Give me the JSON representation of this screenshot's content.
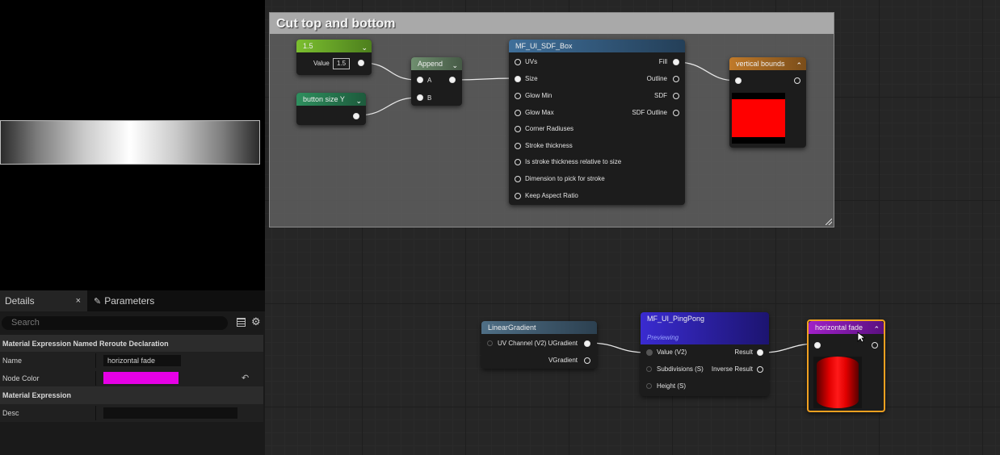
{
  "details": {
    "tab_details": "Details",
    "tab_close": "×",
    "tab_parameters": "Parameters",
    "search_placeholder": "Search",
    "section1": "Material Expression Named Reroute Declaration",
    "name_label": "Name",
    "name_value": "horizontal fade",
    "node_color_label": "Node Color",
    "node_color": "#e600e6",
    "reset_icon": "↶",
    "section2": "Material Expression",
    "desc_label": "Desc",
    "desc_value": ""
  },
  "comment": {
    "title": "Cut top and bottom"
  },
  "nodes": {
    "const": {
      "title": "1.5",
      "value_label": "Value",
      "value": "1.5"
    },
    "button_size": {
      "title": "button size Y"
    },
    "append": {
      "title": "Append",
      "a": "A",
      "b": "B"
    },
    "sdf_box": {
      "title": "MF_UI_SDF_Box",
      "inputs": [
        "UVs",
        "Size",
        "Glow Min",
        "Glow Max",
        "Corner Radiuses",
        "Stroke thickness",
        "Is stroke thickness relative to size",
        "Dimension to pick for stroke",
        "Keep Aspect Ratio"
      ],
      "outputs": [
        "Fill",
        "Outline",
        "SDF",
        "SDF Outline"
      ]
    },
    "vertical_bounds": {
      "title": "vertical bounds"
    },
    "linear_gradient": {
      "title": "LinearGradient",
      "input": "UV Channel (V2)",
      "out1": "UGradient",
      "out2": "VGradient"
    },
    "pingpong": {
      "title": "MF_UI_PingPong",
      "subtitle": "Previewing",
      "in1": "Value (V2)",
      "in2": "Subdivisions (S)",
      "in3": "Height (S)",
      "out1": "Result",
      "out2": "Inverse Result"
    },
    "horizontal_fade": {
      "title": "horizontal fade"
    }
  },
  "colors": {
    "accent_reroute": "#e600e6",
    "preview_red": "#ff0000",
    "selection": "#f0a020"
  }
}
